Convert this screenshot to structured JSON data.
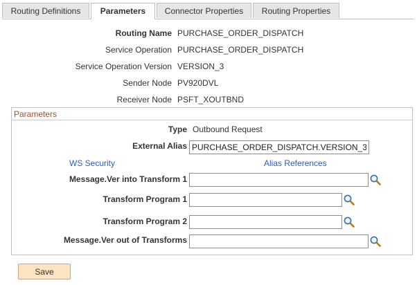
{
  "tabs": [
    {
      "label": "Routing Definitions",
      "active": false
    },
    {
      "label": "Parameters",
      "active": true
    },
    {
      "label": "Connector Properties",
      "active": false
    },
    {
      "label": "Routing Properties",
      "active": false
    }
  ],
  "header": {
    "routing_name_label": "Routing Name",
    "routing_name_value": "PURCHASE_ORDER_DISPATCH",
    "service_operation_label": "Service Operation",
    "service_operation_value": "PURCHASE_ORDER_DISPATCH",
    "service_operation_version_label": "Service Operation Version",
    "service_operation_version_value": "VERSION_3",
    "sender_node_label": "Sender Node",
    "sender_node_value": "PV920DVL",
    "receiver_node_label": "Receiver Node",
    "receiver_node_value": "PSFT_XOUTBND"
  },
  "parameters": {
    "section_title": "Parameters",
    "type_label": "Type",
    "type_value": "Outbound Request",
    "external_alias_label": "External Alias",
    "external_alias_value": "PURCHASE_ORDER_DISPATCH.VERSION_3",
    "ws_security_link": "WS Security",
    "alias_references_link": "Alias References",
    "msg_ver_into_transform_label": "Message.Ver into Transform 1",
    "msg_ver_into_transform_value": "",
    "transform_program_1_label": "Transform Program 1",
    "transform_program_1_value": "",
    "transform_program_2_label": "Transform Program 2",
    "transform_program_2_value": "",
    "msg_ver_out_label": "Message.Ver out of Transforms",
    "msg_ver_out_value": ""
  },
  "actions": {
    "save_label": "Save"
  },
  "icons": {
    "lookup": "magnifier-icon"
  },
  "colors": {
    "section_title": "#a0522d",
    "link": "#2a5db0",
    "save_button": "#fbe4c1"
  }
}
